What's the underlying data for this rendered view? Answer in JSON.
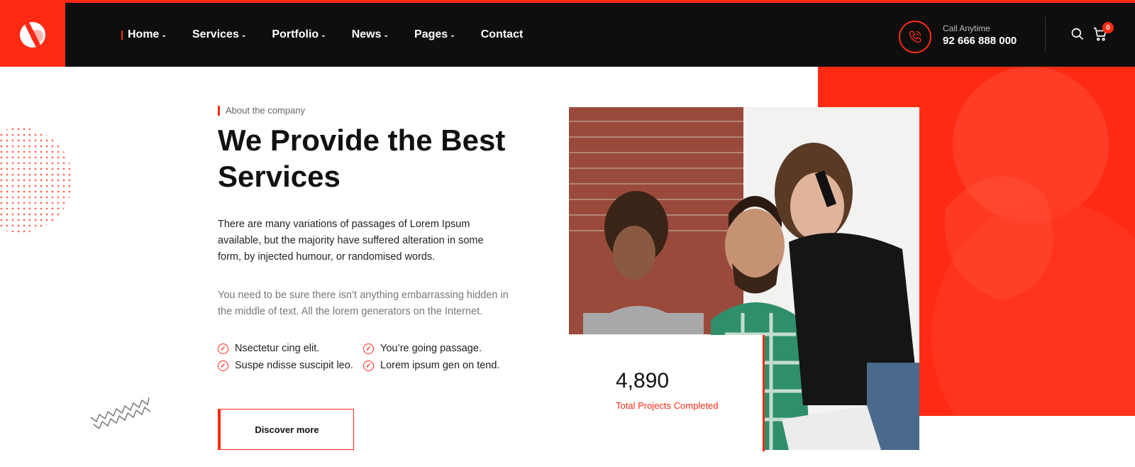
{
  "header": {
    "nav": [
      {
        "label": "Home",
        "active": true,
        "has_dropdown": true
      },
      {
        "label": "Services",
        "has_dropdown": true
      },
      {
        "label": "Portfolio",
        "has_dropdown": true
      },
      {
        "label": "News",
        "has_dropdown": true
      },
      {
        "label": "Pages",
        "has_dropdown": true
      },
      {
        "label": "Contact",
        "has_dropdown": false
      }
    ],
    "call_label": "Call Anytime",
    "call_number": "92 666 888 000",
    "cart_count": "0"
  },
  "about": {
    "eyebrow": "About the company",
    "title": "We Provide the Best Services",
    "paragraph1": "There are many variations of passages of Lorem Ipsum available, but the majority have suffered alteration in some form, by injected humour, or randomised words.",
    "paragraph2": "You need to be sure there isn’t anything embarrassing hidden in the middle of text. All the lorem generators on the Internet.",
    "checks": [
      "Nsectetur cing elit.",
      "You’re going passage.",
      "Suspe ndisse suscipit leo.",
      "Lorem ipsum gen on tend."
    ],
    "button_label": "Discover more"
  },
  "stat": {
    "number": "4,890",
    "label": "Total Projects Completed"
  },
  "colors": {
    "accent": "#ff2a14",
    "header_bg": "#0e0e0e"
  },
  "icons": [
    "logo-icon",
    "phone-icon",
    "search-icon",
    "cart-icon",
    "check-icon",
    "chevron-down-icon"
  ]
}
